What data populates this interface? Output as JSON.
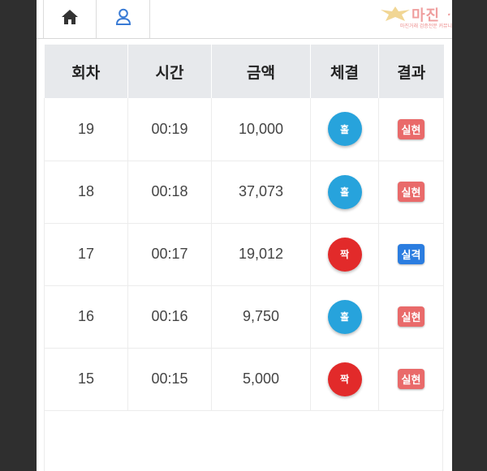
{
  "nav": {
    "home_icon": "home-icon",
    "user_icon": "user-icon",
    "home_color": "#333333",
    "user_color": "#3a7bd5"
  },
  "watermark": {
    "title": "마진",
    "suffix": "…",
    "subtitle": "마진거래 검증전문 커뮤니티"
  },
  "table": {
    "headers": [
      "회차",
      "시간",
      "금액",
      "체결",
      "결과"
    ],
    "rows": [
      {
        "round": "19",
        "time": "00:19",
        "amount": "10,000",
        "side": "홀",
        "side_color": "#27a3dc",
        "result": "실현",
        "result_color": "#e96a6a"
      },
      {
        "round": "18",
        "time": "00:18",
        "amount": "37,073",
        "side": "홀",
        "side_color": "#27a3dc",
        "result": "실현",
        "result_color": "#e96a6a"
      },
      {
        "round": "17",
        "time": "00:17",
        "amount": "19,012",
        "side": "짝",
        "side_color": "#e22a2a",
        "result": "실격",
        "result_color": "#2b7de0"
      },
      {
        "round": "16",
        "time": "00:16",
        "amount": "9,750",
        "side": "홀",
        "side_color": "#27a3dc",
        "result": "실현",
        "result_color": "#e96a6a"
      },
      {
        "round": "15",
        "time": "00:15",
        "amount": "5,000",
        "side": "짝",
        "side_color": "#e22a2a",
        "result": "실현",
        "result_color": "#e96a6a"
      }
    ]
  }
}
